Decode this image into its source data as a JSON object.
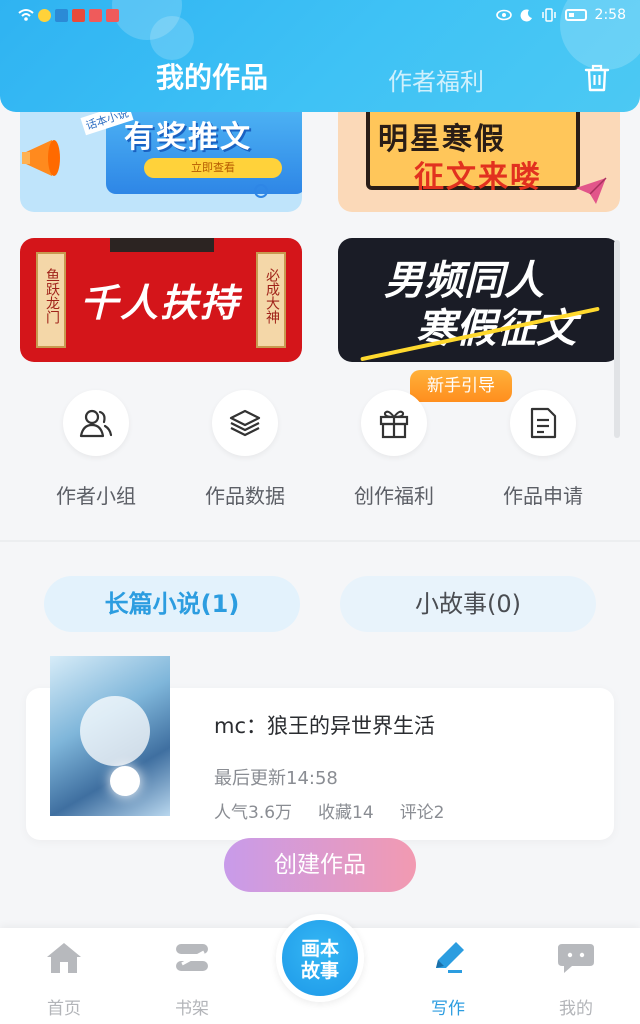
{
  "status_bar": {
    "time": "2:58",
    "icons": [
      "wifi-icon",
      "app-notification-icons",
      "eye-icon",
      "moon-icon",
      "vibrate-icon",
      "battery-icon"
    ]
  },
  "header": {
    "tabs": [
      {
        "label": "我的作品",
        "active": true
      },
      {
        "label": "作者福利",
        "active": false
      }
    ],
    "trash_icon": "trash-icon"
  },
  "banners": [
    {
      "title": "有奖推文",
      "tag": "话本小说",
      "button": "立即查看"
    },
    {
      "line1": "明星寒假",
      "line2": "征文来喽"
    },
    {
      "title": "千人扶持",
      "left_scroll": "鱼跃龙门",
      "right_scroll": "必成大神"
    },
    {
      "line1": "男频同人",
      "line2": "寒假征文"
    }
  ],
  "guide_badge": "新手引导",
  "quick_menu": [
    {
      "label": "作者小组",
      "icon": "group-icon"
    },
    {
      "label": "作品数据",
      "icon": "layers-icon"
    },
    {
      "label": "创作福利",
      "icon": "gift-icon"
    },
    {
      "label": "作品申请",
      "icon": "document-icon"
    }
  ],
  "work_tabs": [
    {
      "label": "长篇小说(1)",
      "active": true
    },
    {
      "label": "小故事(0)",
      "active": false
    }
  ],
  "work": {
    "title": "mc：狼王的异世界生活",
    "updated": "最后更新14:58",
    "popularity": "人气3.6万",
    "favorites": "收藏14",
    "comments": "评论2"
  },
  "create_button": "创建作品",
  "bottom_nav": {
    "items": [
      {
        "label": "首页",
        "icon": "home-icon",
        "active": false
      },
      {
        "label": "书架",
        "icon": "bookshelf-icon",
        "active": false
      },
      {
        "label": "写作",
        "icon": "pencil-icon",
        "active": true
      },
      {
        "label": "我的",
        "icon": "chat-icon",
        "active": false
      }
    ],
    "center": {
      "line1": "画本",
      "line2": "故事"
    }
  },
  "colors": {
    "header": "#35b8f3",
    "accent": "#2c9de0",
    "create_gradient_start": "#c89bea",
    "create_gradient_end": "#f29ab1"
  }
}
